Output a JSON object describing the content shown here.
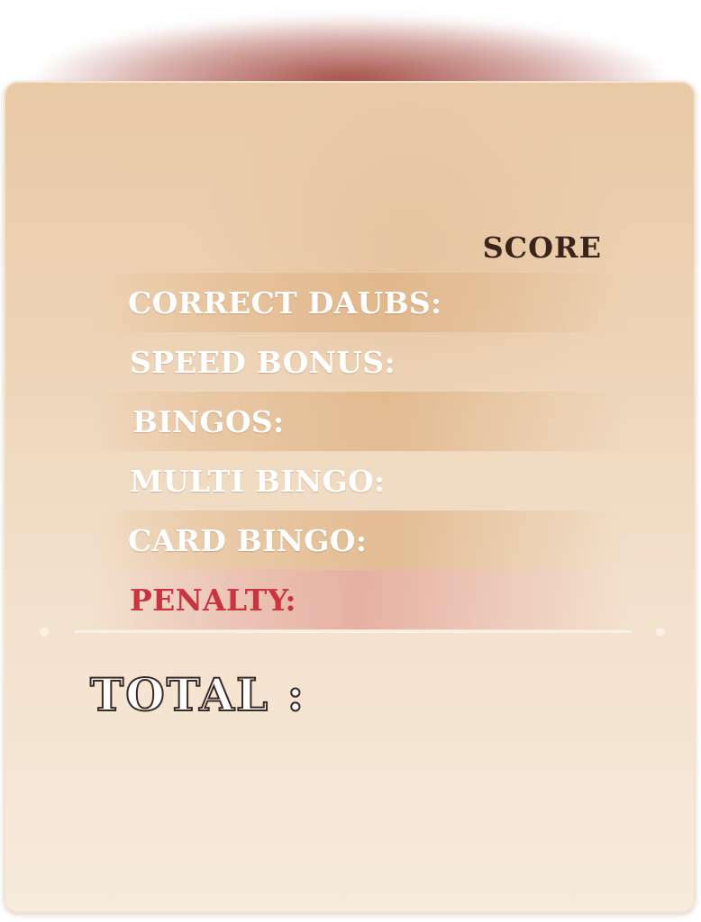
{
  "score_panel": {
    "column_header": "SCORE",
    "rows": [
      {
        "label": "CORRECT DAUBS:"
      },
      {
        "label": "SPEED BONUS:"
      },
      {
        "label": "BINGOS:"
      },
      {
        "label": "MULTI BINGO:"
      },
      {
        "label": "CARD BINGO:"
      },
      {
        "label": "PENALTY:"
      }
    ],
    "total_label": "TOTAL :"
  },
  "colors": {
    "card_top": "#e9c9a6",
    "card_bottom": "#f7ebdc",
    "label_text": "#ffffff",
    "penalty_text": "#c83440",
    "header_text": "#3a241c",
    "glow": "#963228"
  }
}
